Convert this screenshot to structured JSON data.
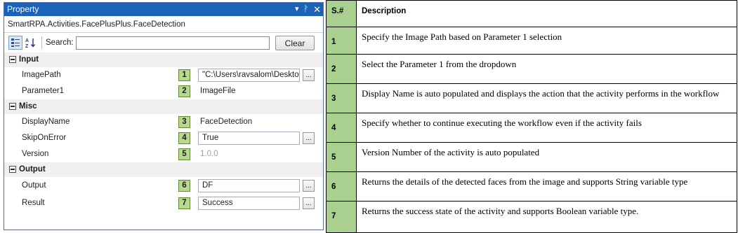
{
  "panel": {
    "title": "Property",
    "title_controls": {
      "dropdown_glyph": "▾",
      "pin_glyph": "ᚹ",
      "close_glyph": "✕"
    },
    "activity_name": "SmartRPA.Activities.FacePlusPlus.FaceDetection",
    "toolbar": {
      "categorized_icon": "categorized-sort-icon",
      "alphabetical_icon": "alphabetical-sort-icon",
      "search_label": "Search:",
      "search_value": "",
      "clear_label": "Clear"
    },
    "categories": [
      {
        "name": "Input",
        "rows": [
          {
            "label": "ImagePath",
            "badge": "1",
            "value": "\"C:\\Users\\ravsalom\\Desktop\\",
            "editable": true,
            "has_button": true
          },
          {
            "label": "Parameter1",
            "badge": "2",
            "value": "ImageFile",
            "editable": false,
            "has_button": false
          }
        ]
      },
      {
        "name": "Misc",
        "rows": [
          {
            "label": "DisplayName",
            "badge": "3",
            "value": "FaceDetection",
            "editable": false,
            "has_button": false
          },
          {
            "label": "SkipOnError",
            "badge": "4",
            "value": "True",
            "editable": true,
            "has_button": true
          },
          {
            "label": "Version",
            "badge": "5",
            "value": "1.0.0",
            "editable": false,
            "has_button": false,
            "muted": true
          }
        ]
      },
      {
        "name": "Output",
        "rows": [
          {
            "label": "Output",
            "badge": "6",
            "value": "DF",
            "editable": true,
            "has_button": true
          },
          {
            "label": "Result",
            "badge": "7",
            "value": "Success",
            "editable": true,
            "has_button": true
          }
        ]
      }
    ],
    "ellipsis_label": "...",
    "colors": {
      "titlebar": "#1c62b9",
      "badge": "#b9d78f",
      "category_bg": "#f0f0f0"
    }
  },
  "table": {
    "headers": {
      "num": "S.#",
      "desc": "Description"
    },
    "rows": [
      {
        "num": "1",
        "desc": "Specify the Image Path based on Parameter 1 selection"
      },
      {
        "num": "2",
        "desc": "Select the Parameter 1 from the dropdown"
      },
      {
        "num": "3",
        "desc": "Display Name is auto populated and displays the action that the activity performs in the workflow"
      },
      {
        "num": "4",
        "desc": "Specify whether to continue executing the workflow even if the activity fails"
      },
      {
        "num": "5",
        "desc": "Version Number of the activity is auto populated"
      },
      {
        "num": "6",
        "desc": "Returns the details of the detected faces from the image and supports String variable type"
      },
      {
        "num": "7",
        "desc": "Returns the success state of the activity and supports Boolean variable type."
      }
    ],
    "colors": {
      "num_col_bg": "#a9d08e"
    }
  }
}
